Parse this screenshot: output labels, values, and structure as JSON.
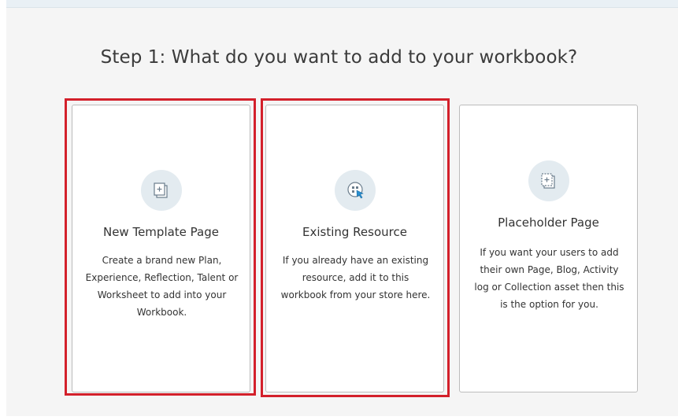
{
  "page": {
    "title": "Step 1: What do you want to add to your workbook?"
  },
  "options": [
    {
      "title": "New Template Page",
      "description": "Create a brand new Plan, Experience, Reflection, Talent or Worksheet to add into your Workbook.",
      "icon": "new-page-icon"
    },
    {
      "title": "Existing Resource",
      "description": "If you already have an existing resource, add it to this workbook from your store here.",
      "icon": "existing-resource-icon"
    },
    {
      "title": "Placeholder Page",
      "description": "If you want your users to add their own Page, Blog, Activity log or Collection asset then this is the option for you.",
      "icon": "placeholder-page-icon"
    }
  ],
  "colors": {
    "highlight": "#d3202b",
    "icon_bg": "#e3ebf0",
    "icon_accent": "#2a8fd0",
    "panel_bg": "#f5f5f5"
  }
}
